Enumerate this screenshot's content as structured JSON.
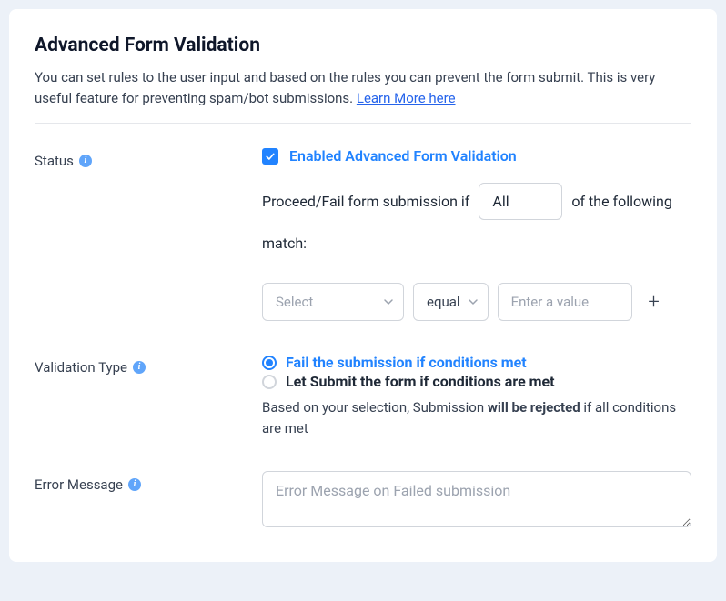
{
  "header": {
    "title": "Advanced Form Validation",
    "description_pre": "You can set rules to the user input and based on the rules you can prevent the form submit. This is very useful feature for preventing spam/bot submissions. ",
    "learn_more": "Learn More here"
  },
  "status": {
    "label": "Status",
    "checkbox_label": "Enabled Advanced Form Validation",
    "checked": true,
    "sentence_pre": "Proceed/Fail form submission if",
    "match_select": "All",
    "sentence_post": "of the following",
    "sentence_line2": "match:",
    "condition": {
      "field_placeholder": "Select",
      "operator": "equal",
      "value_placeholder": "Enter a value"
    }
  },
  "validation_type": {
    "label": "Validation Type",
    "option1": "Fail the submission if conditions met",
    "option2": "Let Submit the form if conditions are met",
    "helper_pre": "Based on your selection, Submission ",
    "helper_bold": "will be rejected",
    "helper_post": " if all conditions are met"
  },
  "error_message": {
    "label": "Error Message",
    "placeholder": "Error Message on Failed submission"
  }
}
